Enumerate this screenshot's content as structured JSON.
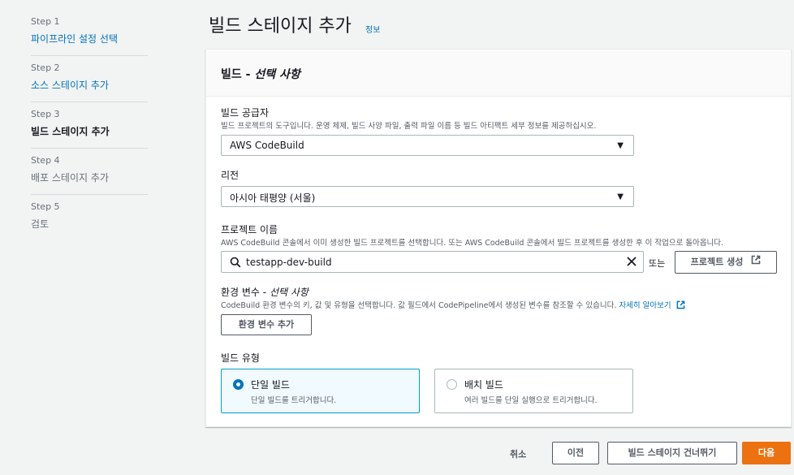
{
  "steps": [
    {
      "num": "Step 1",
      "label": "파이프라인 설정 선택"
    },
    {
      "num": "Step 2",
      "label": "소스 스테이지 추가"
    },
    {
      "num": "Step 3",
      "label": "빌드 스테이지 추가"
    },
    {
      "num": "Step 4",
      "label": "배포 스테이지 추가"
    },
    {
      "num": "Step 5",
      "label": "검토"
    }
  ],
  "header": {
    "title": "빌드 스테이지 추가",
    "info": "정보"
  },
  "panel": {
    "title": "빌드 - ",
    "title_optional": "선택 사항",
    "provider": {
      "label": "빌드 공급자",
      "desc": "빌드 프로젝트의 도구입니다. 운영 체제, 빌드 사양 파일, 출력 파일 이름 등 빌드 아티팩트 세부 정보를 제공하십시오.",
      "value": "AWS CodeBuild"
    },
    "region": {
      "label": "리전",
      "value": "아시아 태평양 (서울)"
    },
    "project": {
      "label": "프로젝트 이름",
      "desc": "AWS CodeBuild 콘솔에서 이미 생성한 빌드 프로젝트를 선택합니다. 또는 AWS CodeBuild 콘솔에서 빌드 프로젝트를 생성한 후 이 작업으로 돌아옵니다.",
      "value": "testapp-dev-build",
      "or": "또는",
      "create_button": "프로젝트 생성"
    },
    "env": {
      "label": "환경 변수 - ",
      "label_optional": "선택 사항",
      "desc": "CodeBuild 환경 변수의 키, 값 및 유형을 선택합니다. 값 필드에서 CodePipeline에서 생성된 변수를 참조할 수 있습니다.",
      "learn_more": "자세히 알아보기",
      "add_button": "환경 변수 추가"
    },
    "build_type": {
      "label": "빌드 유형",
      "options": [
        {
          "title": "단일 빌드",
          "desc": "단일 빌드를 트리거합니다.",
          "selected": true
        },
        {
          "title": "배치 빌드",
          "desc": "여러 빌드를 단일 실행으로 트리거합니다.",
          "selected": false
        }
      ]
    }
  },
  "footer": {
    "cancel": "취소",
    "previous": "이전",
    "skip": "빌드 스테이지 건너뛰기",
    "next": "다음"
  },
  "colors": {
    "link": "#0073bb",
    "primary": "#ec7211",
    "selected_border": "#00a1c9"
  }
}
